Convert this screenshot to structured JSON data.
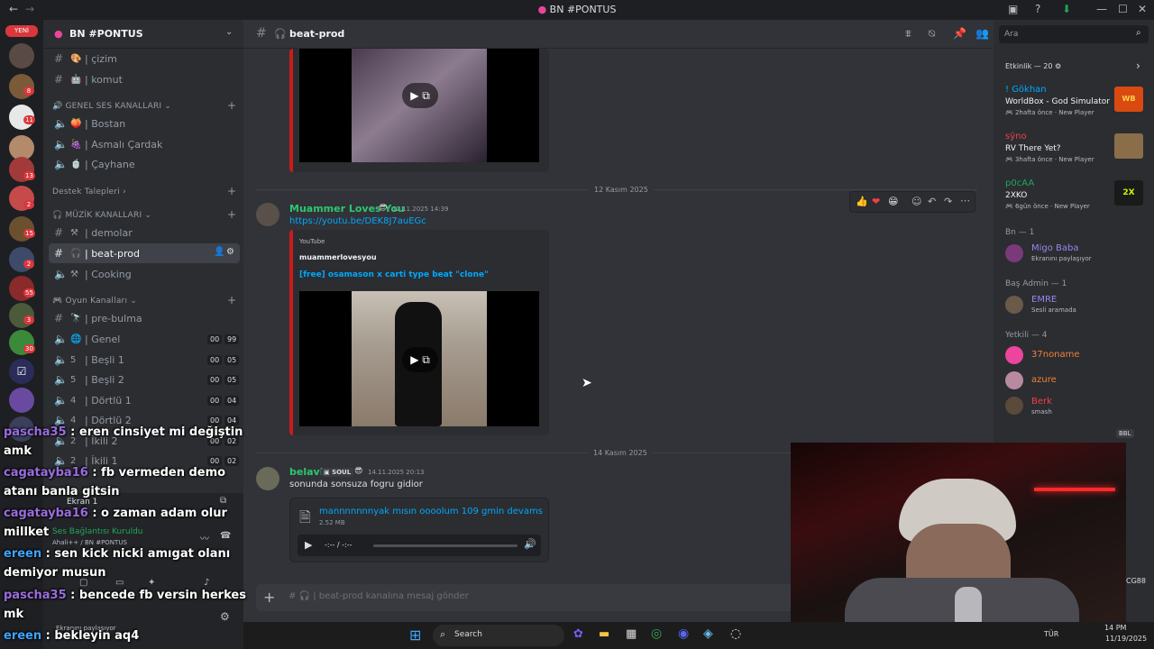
{
  "window": {
    "title": "BN #PONTUS"
  },
  "servers": {
    "new_label": "YENİ",
    "badges": [
      "8",
      "11",
      "13",
      "2",
      "15",
      "2",
      "55",
      "3",
      "30"
    ]
  },
  "sidebar": {
    "server_name": "BN #PONTUS",
    "channels_top": [
      {
        "sym": "#",
        "label": "| çizim"
      },
      {
        "sym": "#",
        "label": "| komut"
      }
    ],
    "cat_voice": "GENEL SES KANALLARI",
    "voice_channels": [
      {
        "label": "| Bostan"
      },
      {
        "label": "| Asmalı Çardak"
      },
      {
        "label": "| Çayhane"
      }
    ],
    "support": "Destek Talepleri",
    "cat_music": "MÜZİK KANALLARI",
    "music_channels": [
      {
        "label": "| demolar"
      },
      {
        "label": "| beat-prod"
      },
      {
        "label": "| Cooking"
      }
    ],
    "cat_games": "Oyun Kanalları",
    "game_channels": [
      {
        "label": "| pre-bulma",
        "c1": "",
        "c2": ""
      },
      {
        "label": "| Genel",
        "c1": "00",
        "c2": "99"
      },
      {
        "label": "| Beşli 1",
        "c1": "00",
        "c2": "05"
      },
      {
        "label": "| Beşli 2",
        "c1": "00",
        "c2": "05"
      },
      {
        "label": "| Dörtlü 1",
        "c1": "00",
        "c2": "04"
      },
      {
        "label": "| Dörtlü 2",
        "c1": "00",
        "c2": "04"
      },
      {
        "label": "| İkili 2",
        "c1": "00",
        "c2": "02"
      },
      {
        "label": "| İkili 1",
        "c1": "00",
        "c2": "02"
      }
    ],
    "screen_share": "Ekran 1",
    "voice_connected": "Ses Bağlantısı Kuruldu",
    "voice_location": "Ahali++ / BN #PONTUS",
    "user_status": "Ekranını paylaşıyor"
  },
  "main": {
    "channel": "beat-prod",
    "divider1": "12 Kasım 2025",
    "msg1": {
      "author": "Muammer Loves You",
      "timestamp": "12.11.2025 14:39",
      "link": "https://youtu.be/DEK8J7auEGc",
      "provider": "YouTube",
      "channel": "muammerlovesyou",
      "video_title": "[free] osamason x carti type beat \"clone\""
    },
    "divider2": "14 Kasım 2025",
    "msg2": {
      "author": "belavil",
      "tag": "SOUL",
      "timestamp": "14.11.2025 20:13",
      "text": "sonunda sonsuza fogru gidior",
      "file_name": "mannnnnnnyak mısın oooolum 109 gmin devamsss.mp",
      "file_size": "2.52 MB",
      "time_display": "-:-- / -:--"
    },
    "input_placeholder": "| beat-prod kanalına mesaj gönder"
  },
  "search": {
    "placeholder": "Ara"
  },
  "members": {
    "activity_header": "Etkinlik — 20",
    "activities": [
      {
        "user": "! Gökhan",
        "game": "WorldBox - God Simulator",
        "time": "2hafta önce",
        "tag": "New Player"
      },
      {
        "user": "sÿno",
        "game": "RV There Yet?",
        "time": "3hafta önce",
        "tag": "New Player"
      },
      {
        "user": "p0cAA",
        "game": "2XKO",
        "time": "6gün önce",
        "tag": "New Player"
      }
    ],
    "group1": "Bn — 1",
    "m1": {
      "name": "Migo Baba",
      "status": "Ekranını paylaşıyor"
    },
    "group2": "Baş Admin — 1",
    "m2": {
      "name": "EMRE",
      "status": "Sesli aramada"
    },
    "group3": "Yetkili — 4",
    "m3": {
      "name": "37noname"
    },
    "m4": {
      "name": "azure"
    },
    "m5": {
      "name": "Berk",
      "status": "smash"
    },
    "bbl": "BBL"
  },
  "overlay_chat": [
    {
      "user": "pascha35",
      "text": " : eren cinsiyet mi değiştin",
      "cls": "u1"
    },
    {
      "user": "",
      "text": "amk",
      "cls": ""
    },
    {
      "user": "cagatayba16",
      "text": " : fb vermeden demo",
      "cls": "u1"
    },
    {
      "user": "",
      "text": "atanı banla gitsin",
      "cls": ""
    },
    {
      "user": "cagatayba16",
      "text": " : o zaman adam olur",
      "cls": "u1"
    },
    {
      "user": "",
      "text": "millket",
      "cls": ""
    },
    {
      "user": "ereen",
      "text": " : sen kick nicki amıgat olanı",
      "cls": "u2"
    },
    {
      "user": "",
      "text": "demiyor musun",
      "cls": ""
    },
    {
      "user": "pascha35",
      "text": " : bencede fb versin herkes",
      "cls": "u1"
    },
    {
      "user": "",
      "text": "mk",
      "cls": ""
    },
    {
      "user": "ereen",
      "text": " : bekleyin aq4",
      "cls": "u2"
    }
  ],
  "taskbar": {
    "search": "Search",
    "lang": "TÜR",
    "time": "14 PM",
    "date": "11/19/2025",
    "side": "CG88"
  }
}
